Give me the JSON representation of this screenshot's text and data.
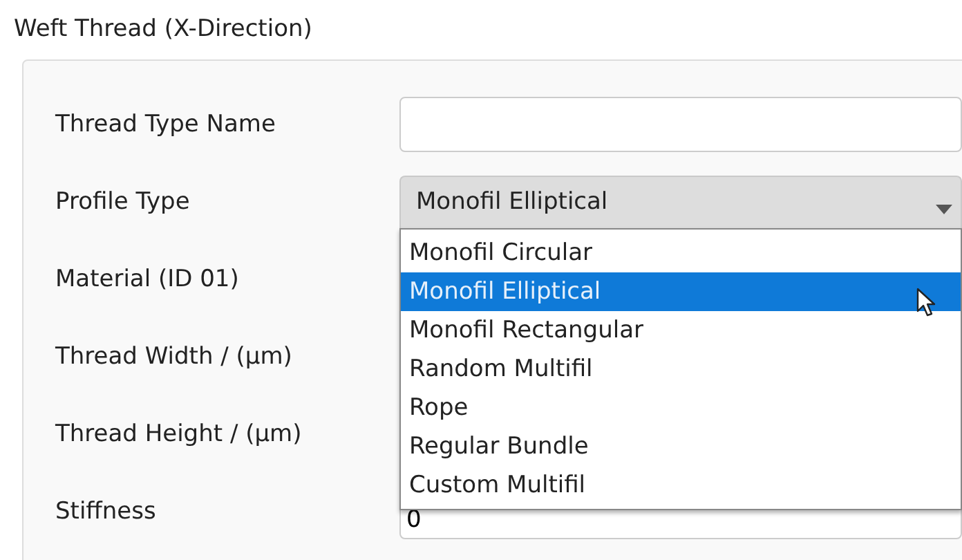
{
  "group": {
    "title": "Weft Thread (X-Direction)"
  },
  "fields": [
    {
      "kind": "text",
      "label": "Thread Type Name"
    },
    {
      "kind": "combo",
      "label": "Profile Type",
      "value": "Monofil Elliptical",
      "expanded": true,
      "options": [
        {
          "label": "Monofil Circular",
          "selected": false
        },
        {
          "label": "Monofil Elliptical",
          "selected": true
        },
        {
          "label": "Monofil Rectangular",
          "selected": false
        },
        {
          "label": "Random Multifil",
          "selected": false
        },
        {
          "label": "Rope",
          "selected": false
        },
        {
          "label": "Regular Bundle",
          "selected": false
        },
        {
          "label": "Custom Multifil",
          "selected": false
        }
      ]
    },
    {
      "kind": "covered",
      "label": "Material (ID 01)"
    },
    {
      "kind": "covered",
      "label": "Thread Width / (µm)"
    },
    {
      "kind": "covered",
      "label": "Thread Height / (µm)"
    },
    {
      "kind": "text",
      "label": "Stiffness",
      "value": "0"
    }
  ]
}
